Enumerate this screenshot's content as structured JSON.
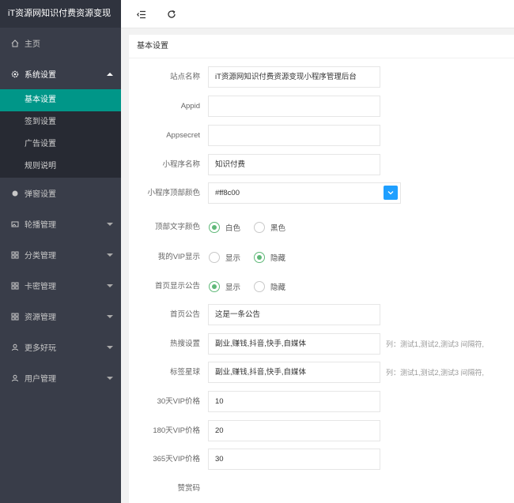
{
  "app": {
    "title": "iT资源网知识付费资源变现"
  },
  "sidebar": {
    "items": [
      {
        "label": "主页",
        "icon": "home-icon"
      },
      {
        "label": "系统设置",
        "icon": "gear-icon"
      },
      {
        "label": "弹窗设置",
        "icon": "dot-icon"
      },
      {
        "label": "轮播管理",
        "icon": "image-icon"
      },
      {
        "label": "分类管理",
        "icon": "grid-icon"
      },
      {
        "label": "卡密管理",
        "icon": "grid-icon"
      },
      {
        "label": "资源管理",
        "icon": "grid-icon"
      },
      {
        "label": "更多好玩",
        "icon": "user-icon"
      },
      {
        "label": "用户管理",
        "icon": "user-icon"
      }
    ],
    "submenu": [
      {
        "label": "基本设置",
        "active": true
      },
      {
        "label": "签到设置"
      },
      {
        "label": "广告设置"
      },
      {
        "label": "规则说明"
      }
    ]
  },
  "topbar": {
    "menu_icon": "menu-fold-icon",
    "refresh_icon": "refresh-icon"
  },
  "panel": {
    "title": "基本设置"
  },
  "form": {
    "site_name": {
      "label": "站点名称",
      "value": "iT资源网知识付费资源变现小程序管理后台"
    },
    "appid": {
      "label": "Appid",
      "value": ""
    },
    "appsecret": {
      "label": "Appsecret",
      "value": ""
    },
    "mini_name": {
      "label": "小程序名称",
      "value": "知识付费"
    },
    "top_color": {
      "label": "小程序顶部颜色",
      "value": "#ff8c00"
    },
    "top_text_color": {
      "label": "顶部文字颜色",
      "options": [
        "白色",
        "黑色"
      ],
      "selected": "白色"
    },
    "my_vip": {
      "label": "我的VIP显示",
      "options": [
        "显示",
        "隐藏"
      ],
      "selected": "隐藏"
    },
    "home_notice_show": {
      "label": "首页显示公告",
      "options": [
        "显示",
        "隐藏"
      ],
      "selected": "显示"
    },
    "home_notice": {
      "label": "首页公告",
      "value": "这是一条公告"
    },
    "hot_search": {
      "label": "热搜设置",
      "value": "副业,赚钱,抖音,快手,自媒体",
      "hint": "列：测试1,测试2,测试3 间隔符,"
    },
    "tag_ball": {
      "label": "标签星球",
      "value": "副业,赚钱,抖音,快手,自媒体",
      "hint": "列：测试1,测试2,测试3 间隔符,"
    },
    "vip30": {
      "label": "30天VIP价格",
      "value": "10"
    },
    "vip180": {
      "label": "180天VIP价格",
      "value": "20"
    },
    "vip365": {
      "label": "365天VIP价格",
      "value": "30"
    },
    "reward_code": {
      "label": "赞赏码"
    }
  },
  "colors": {
    "sidebar": "#393d49",
    "active": "#009688",
    "radio": "#5fb878",
    "button": "#1e9fff"
  }
}
